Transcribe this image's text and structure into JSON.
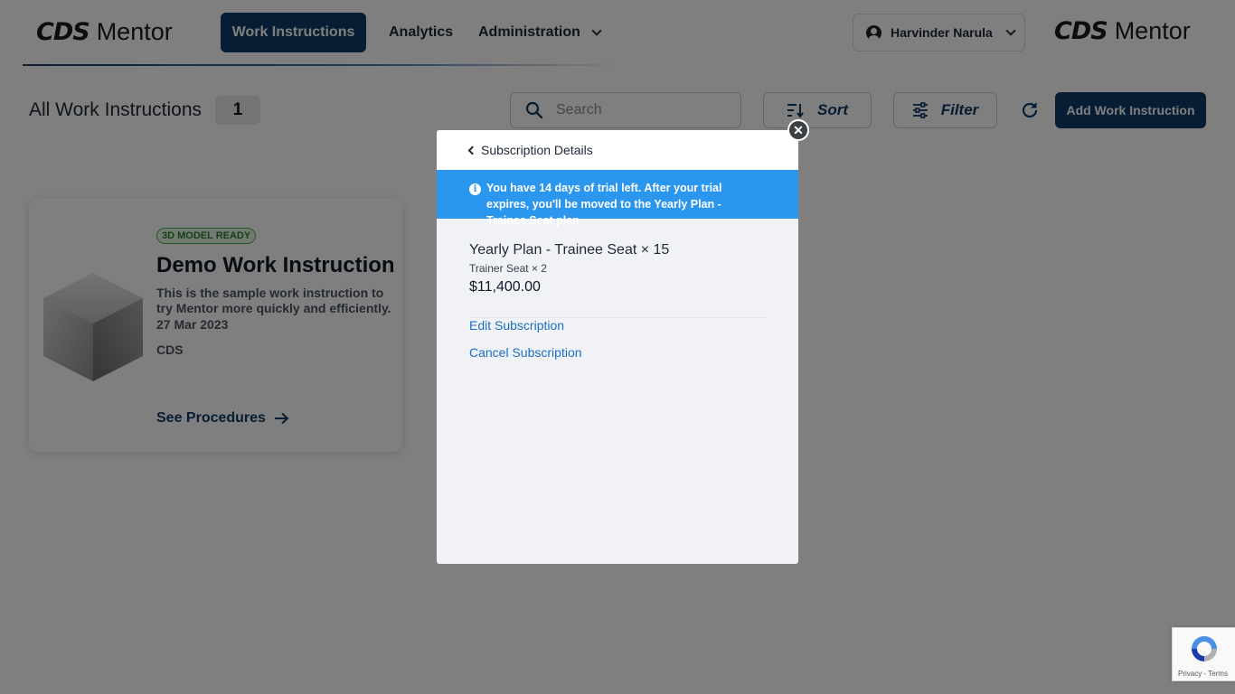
{
  "brand": {
    "logo_mark": "CDS",
    "logo_name": "Mentor"
  },
  "nav": {
    "work_instructions": "Work Instructions",
    "analytics": "Analytics",
    "administration": "Administration"
  },
  "user": {
    "name": "Harvinder Narula"
  },
  "toolbar": {
    "title": "All Work Instructions",
    "count": "1",
    "search_placeholder": "Search",
    "sort_label": "Sort",
    "filter_label": "Filter",
    "add_label": "Add Work Instruction"
  },
  "card": {
    "badge": "3D MODEL READY",
    "title": "Demo Work Instruction",
    "description": "This is the sample work instruction to try Mentor more quickly and efficiently.",
    "date": "27 Mar 2023",
    "owner": "CDS",
    "action": "See Procedures"
  },
  "modal": {
    "header": "Subscription Details",
    "banner": "You have 14 days of trial left. After your trial expires, you'll be moved to the Yearly Plan - Trainee Seat plan",
    "plan_name": "Yearly Plan - Trainee Seat × 15",
    "plan_sub": "Trainer Seat × 2",
    "price": "$11,400.00",
    "edit_link": "Edit Subscription",
    "cancel_link": "Cancel Subscription",
    "close_icon": "close-icon"
  },
  "recaptcha": {
    "text": "Privacy - Terms"
  },
  "colors": {
    "primary": "#0d3b66",
    "banner": "#2b96ed",
    "link": "#1a6fc4",
    "badge_green": "#2f7d32"
  }
}
